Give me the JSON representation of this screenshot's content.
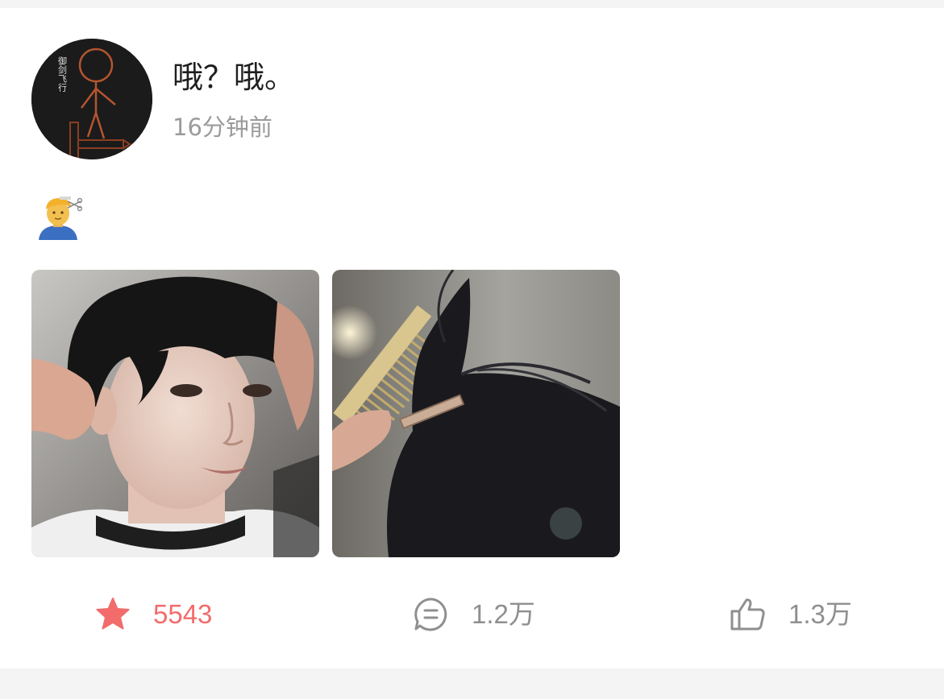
{
  "post": {
    "author": {
      "name": "哦？哦。",
      "avatar_icon": "stick-figure-sword-avatar",
      "avatar_text": "御剑飞行",
      "time": "16分钟前"
    },
    "content": {
      "emoji_icon": "haircut-emoji-icon"
    },
    "images": [
      {
        "alt_icon": "portrait-haircut-photo"
      },
      {
        "alt_icon": "hair-clip-comb-photo"
      }
    ],
    "actions": {
      "favorite": {
        "icon": "star-icon",
        "count": "5543",
        "color": "#f26c6c",
        "active": true
      },
      "comment": {
        "icon": "comment-icon",
        "count": "1.2万"
      },
      "like": {
        "icon": "thumbs-up-icon",
        "count": "1.3万"
      }
    }
  },
  "colors": {
    "background": "#f4f4f4",
    "card": "#ffffff",
    "accent": "#f26c6c",
    "muted": "#9b9b9b"
  }
}
